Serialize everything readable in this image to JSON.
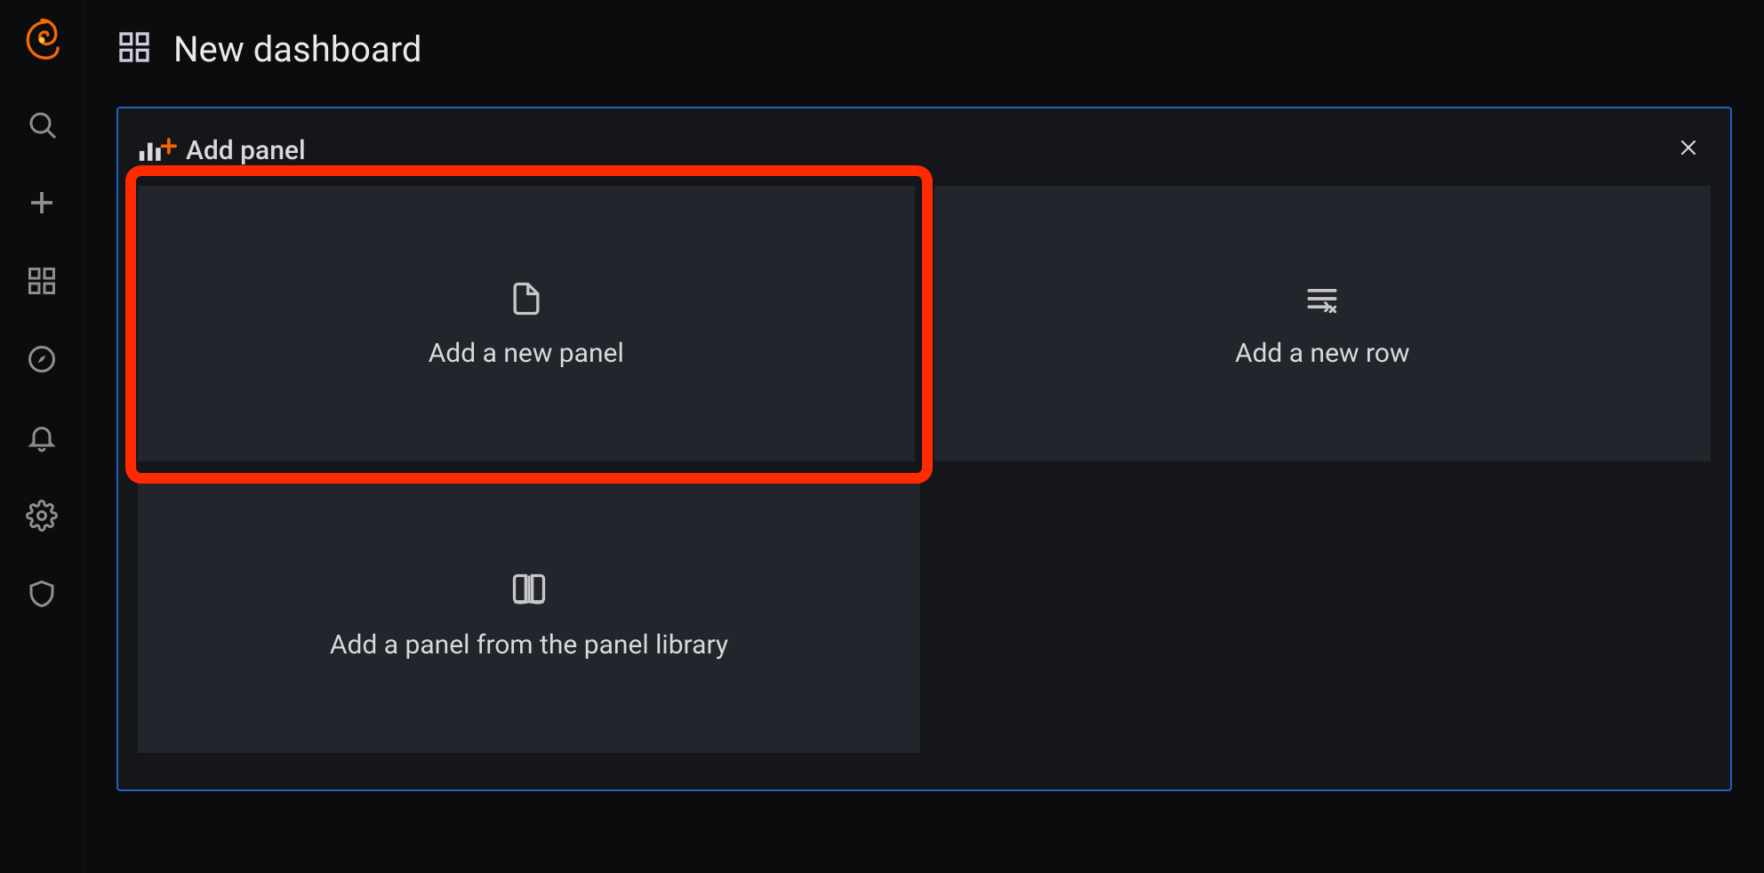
{
  "page": {
    "title": "New dashboard"
  },
  "sidebar": {
    "items": [
      {
        "name": "search-icon"
      },
      {
        "name": "plus-icon"
      },
      {
        "name": "dashboards-icon"
      },
      {
        "name": "compass-icon"
      },
      {
        "name": "bell-icon"
      },
      {
        "name": "gear-icon"
      },
      {
        "name": "shield-icon"
      }
    ]
  },
  "panel": {
    "header_label": "Add panel",
    "close_label": "Close",
    "cards": {
      "add_panel": "Add a new panel",
      "add_row": "Add a new row",
      "panel_library": "Add a panel from the panel library"
    },
    "highlighted_card": "add_panel"
  },
  "colors": {
    "accent_border": "#1f60c4",
    "highlight_red": "#ff2a00",
    "card_bg": "#22252b",
    "bg": "#0b0c0e"
  }
}
